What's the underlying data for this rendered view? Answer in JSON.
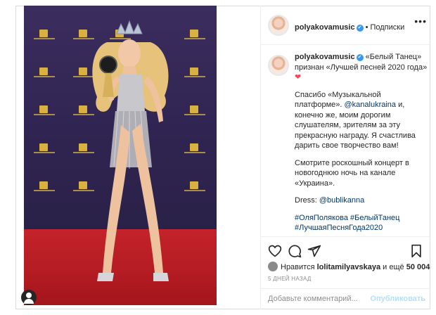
{
  "post": {
    "username": "polyakovamusic",
    "verified_badge": "✔",
    "separator": "•",
    "follow_label": "Подписки",
    "more_icon": "more-horizontal-icon"
  },
  "caption": {
    "username": "polyakovamusic",
    "headline": "«Белый Танец» признан «Лучшей песней 2020 года»",
    "heart": "❤",
    "p1_before": "Спасибо «Музыкальной платформе». ",
    "p1_mention": "@kanalukraina",
    "p1_after": " и, конечно же, моим дорогим слушателям, зрителям за эту прекрасную награду. Я счастлива дарить свое творчество вам!",
    "p2": "Смотрите роскошный концерт в новогоднюю ночь на канале «Украина».",
    "p3_label": "Dress: ",
    "p3_mention": "@bublikanna",
    "tag1": "#ОляПолякова",
    "tag2": "#БелыйТанец",
    "tag3": "#ЛучшаяПесняГода2020"
  },
  "actions": {
    "like_icon": "heart-icon",
    "comment_icon": "comment-icon",
    "share_icon": "share-icon",
    "save_icon": "bookmark-icon"
  },
  "likes": {
    "prefix": "Нравится ",
    "user": "lolitamilyavskaya",
    "suffix": " и ещё ",
    "count": "50 004"
  },
  "timestamp": "5 ДНЕЙ НАЗАД",
  "comment": {
    "placeholder": "Добавьте комментарий...",
    "publish_label": "Опубликовать"
  },
  "colors": {
    "link": "#00376b",
    "verified": "#3897f0",
    "heart": "#ed4956",
    "publish_disabled": "#b2dffc"
  }
}
